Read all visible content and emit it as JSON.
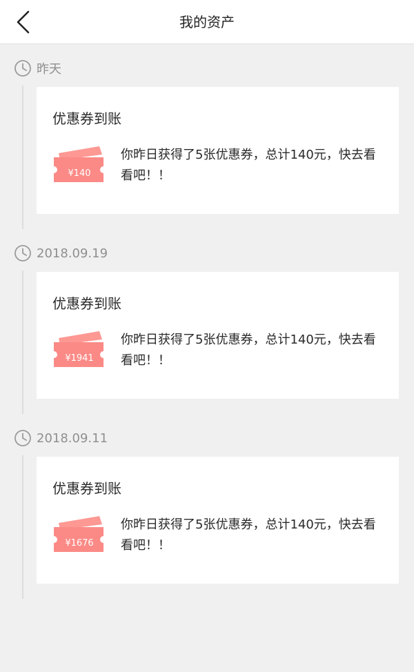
{
  "header": {
    "title": "我的资产"
  },
  "colors": {
    "coupon": "#fb8a86",
    "coupon_tab": "#fd9893",
    "timeline_line": "#dcdcdc",
    "date_text": "#8f8f8f",
    "background": "#f0f0f0"
  },
  "icons": {
    "back": "chevron-left-icon",
    "clock": "clock-icon",
    "coupon": "coupon-ticket-icon"
  },
  "entries": [
    {
      "date": "昨天",
      "card_title": "优惠券到账",
      "coupon_amount": "¥140",
      "message": "你昨日获得了5张优惠券，总计140元，快去看看吧！！"
    },
    {
      "date": "2018.09.19",
      "card_title": "优惠券到账",
      "coupon_amount": "¥1941",
      "message": "你昨日获得了5张优惠券，总计140元，快去看看吧！！"
    },
    {
      "date": "2018.09.11",
      "card_title": "优惠券到账",
      "coupon_amount": "¥1676",
      "message": "你昨日获得了5张优惠券，总计140元，快去看看吧！！"
    }
  ]
}
